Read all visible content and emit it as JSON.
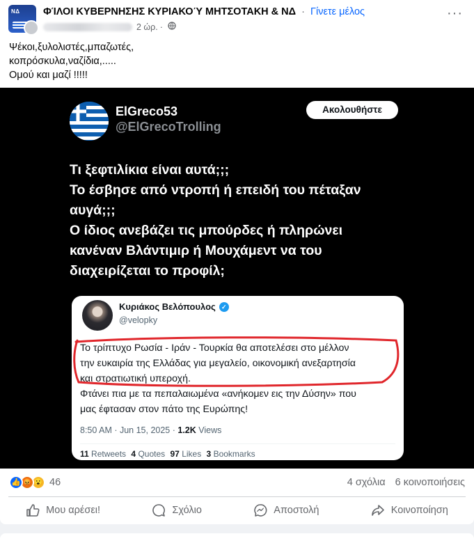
{
  "post": {
    "group_name": "ΦΊΛΟΙ ΚΥΒΕΡΝΗΣΗΣ ΚΥΡΙΑΚΟΎ ΜΗΤΣΟΤΑΚΗ & ΝΔ",
    "separator": "·",
    "join_label": "Γίνετε μέλος",
    "time": "2 ώρ.",
    "dot": "·",
    "more_label": "···",
    "text_lines": [
      "Ψέκοι,ξυλολιστές,μπαζωτές,",
      "κοπρόσκυλα,ναζίδια,.....",
      "Ομού και μαζί !!!!!"
    ]
  },
  "tweet": {
    "name": "ElGreco53",
    "handle": "@ElGrecoTrolling",
    "follow_label": "Ακολουθήστε",
    "text_lines": [
      "Τι ξεφτιλίκια είναι αυτά;;;",
      "Το έσβησε από ντροπή ή επειδή του πέταξαν",
      "αυγά;;;",
      "Ο ίδιος ανεβάζει τις μπούρδες ή πληρώνει",
      "κανέναν Βλάντιμιρ ή Μουχάμεντ να του",
      "διαχειρίζεται το προφίλ;"
    ]
  },
  "quoted": {
    "name": "Κυριάκος Βελόπουλος",
    "handle": "@velopky",
    "body_lines": [
      "Το τρίπτυχο Ρωσία - Ιράν - Τουρκία θα αποτελέσει στο μέλλον",
      "την ευκαιρία της Ελλάδας για μεγαλείο, οικονομική ανεξαρτησία",
      "και στρατιωτική υπεροχή.",
      "Φτάνει πια με τα πεπαλαιωμένα «ανήκομεν εις την Δύσην» που",
      "μας έφτασαν στον πάτο της Ευρώπης!"
    ],
    "time": "8:50 AM · Jun 15, 2025 ·",
    "views_count": "1.2K",
    "views_label": "Views",
    "retweets_count": "11",
    "retweets_label": "Retweets",
    "quotes_count": "4",
    "quotes_label": "Quotes",
    "likes_count": "97",
    "likes_label": "Likes",
    "bookmarks_count": "3",
    "bookmarks_label": "Bookmarks"
  },
  "footer": {
    "reaction_count": "46",
    "comments_label": "4 σχόλια",
    "shares_label": "6 κοινοποιήσεις",
    "like_label": "Μου αρέσει!",
    "comment_label": "Σχόλιο",
    "send_label": "Αποστολή",
    "share_label": "Κοινοποίηση"
  },
  "colors": {
    "facebook_blue": "#0866ff",
    "highlight_red": "#e0262b",
    "greek_flag_blue": "#0d5eaf"
  }
}
